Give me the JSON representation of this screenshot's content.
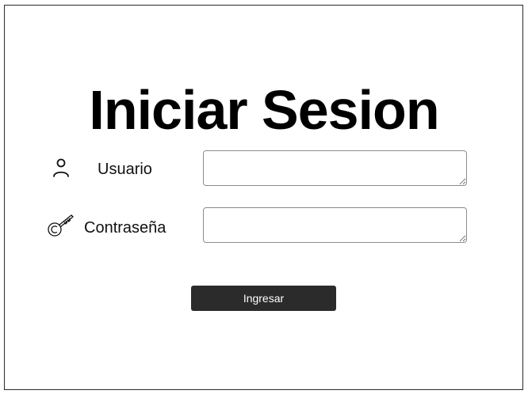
{
  "title": "Iniciar Sesion",
  "form": {
    "username": {
      "label": "Usuario",
      "value": "",
      "icon": "user-icon"
    },
    "password": {
      "label": "Contraseña",
      "value": "",
      "icon": "key-icon"
    },
    "submit_label": "Ingresar"
  },
  "colors": {
    "button_bg": "#2b2b2b",
    "button_text": "#ffffff",
    "border": "#8c8c8c",
    "background": "#ffffff"
  }
}
